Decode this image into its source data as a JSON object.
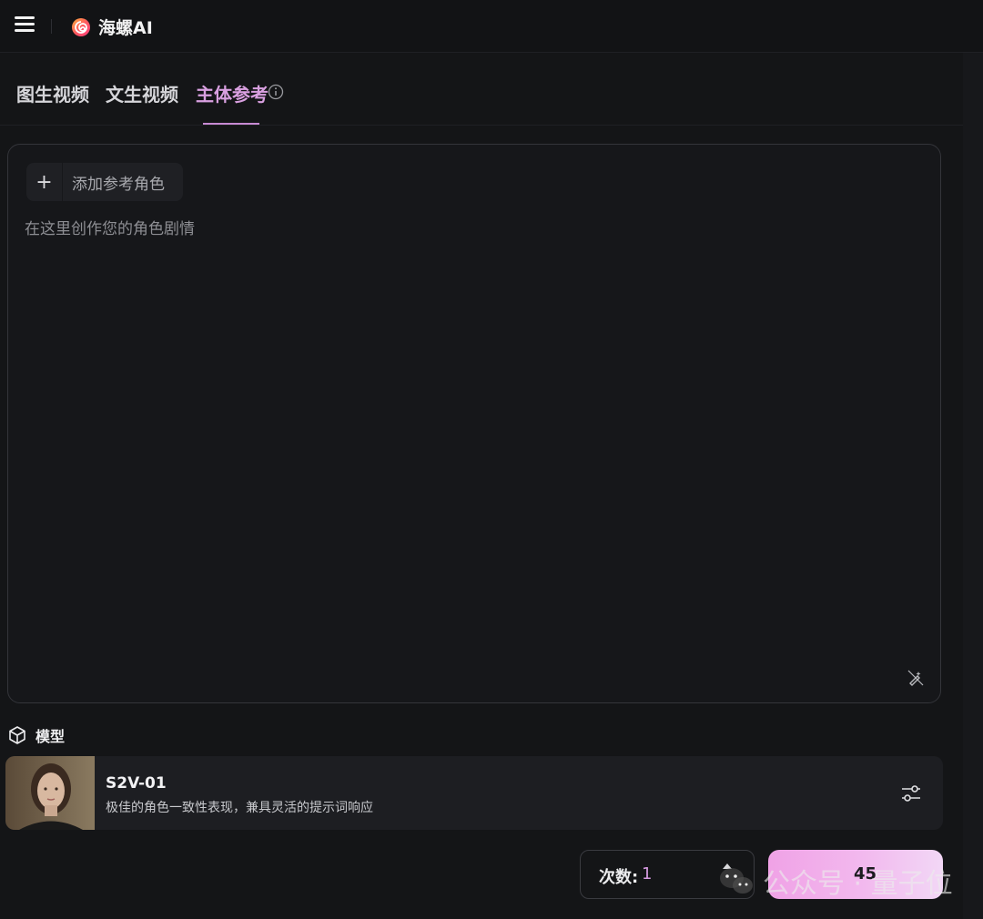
{
  "app": {
    "name": "海螺AI"
  },
  "tabs": [
    {
      "label": "图生视频",
      "active": false
    },
    {
      "label": "文生视频",
      "active": false
    },
    {
      "label": "主体参考",
      "active": true
    }
  ],
  "editor": {
    "add_role_label": "添加参考角色",
    "add_icon": "+",
    "prompt_placeholder": "在这里创作您的角色剧情",
    "prompt_value": ""
  },
  "model": {
    "section_label": "模型",
    "name": "S2V-01",
    "description": "极佳的角色一致性表现，兼具灵活的提示词响应"
  },
  "generate": {
    "count_label": "次数:",
    "count_value": "1",
    "cost": "45"
  },
  "watermark": {
    "text": "公众号 · 量子位"
  },
  "colors": {
    "accent": "#d9a0e0",
    "background": "#141517",
    "button_gradient_start": "#f0a2e6",
    "button_gradient_end": "#f2d7f6"
  },
  "icons": [
    "menu-icon",
    "snail-logo-icon",
    "info-icon",
    "plus-icon",
    "magic-wand-icon",
    "cube-icon",
    "tune-icon",
    "stepper-up-icon",
    "wechat-icon"
  ]
}
